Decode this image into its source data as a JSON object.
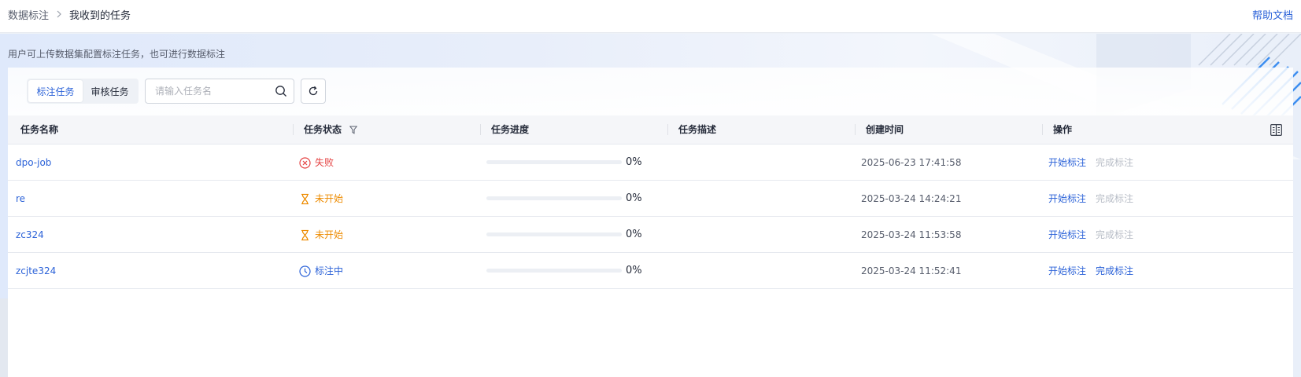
{
  "breadcrumb": {
    "root": "数据标注",
    "current": "我收到的任务"
  },
  "help_label": "帮助文档",
  "description": "用户可上传数据集配置标注任务，也可进行数据标注",
  "tabs": [
    {
      "label": "标注任务",
      "active": true
    },
    {
      "label": "审核任务",
      "active": false
    }
  ],
  "search": {
    "placeholder": "请输入任务名",
    "value": ""
  },
  "columns": {
    "name": "任务名称",
    "status": "任务状态",
    "progress": "任务进度",
    "description": "任务描述",
    "created": "创建时间",
    "actions": "操作"
  },
  "actions": {
    "start": "开始标注",
    "finish": "完成标注"
  },
  "colors": {
    "accent": "#2b62d8",
    "failed": "#e54545",
    "pending": "#ed8b00",
    "running": "#2b62d8"
  },
  "rows": [
    {
      "name": "dpo-job",
      "status": "失败",
      "status_icon": "failed-circle-icon",
      "progress": 0,
      "progress_label": "0%",
      "description": "",
      "created": "2025-06-23 17:41:58",
      "finish_enabled": false
    },
    {
      "name": "re",
      "status": "未开始",
      "status_icon": "hourglass-icon",
      "progress": 0,
      "progress_label": "0%",
      "description": "",
      "created": "2025-03-24 14:24:21",
      "finish_enabled": false
    },
    {
      "name": "zc324",
      "status": "未开始",
      "status_icon": "hourglass-icon",
      "progress": 0,
      "progress_label": "0%",
      "description": "",
      "created": "2025-03-24 11:53:58",
      "finish_enabled": false
    },
    {
      "name": "zcjte324",
      "status": "标注中",
      "status_icon": "clock-icon",
      "progress": 0,
      "progress_label": "0%",
      "description": "",
      "created": "2025-03-24 11:52:41",
      "finish_enabled": true
    }
  ]
}
